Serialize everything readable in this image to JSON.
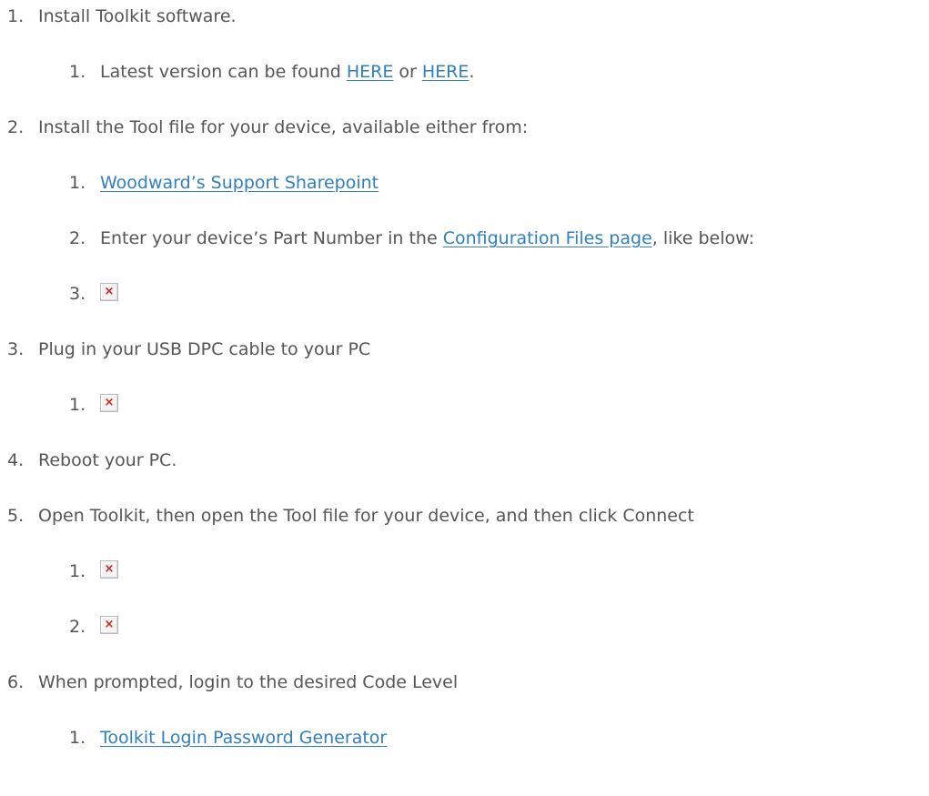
{
  "steps": [
    {
      "num": "1.",
      "text": "Install Toolkit software.",
      "sub": [
        {
          "num": "1.",
          "pre": "Latest version can be found ",
          "link1": "HERE",
          "mid": " or ",
          "link2": "HERE",
          "post": "."
        }
      ]
    },
    {
      "num": "2.",
      "text": "Install the Tool file for your device, available either from:",
      "sub": [
        {
          "num": "1.",
          "link": "Woodward’s Support Sharepoint"
        },
        {
          "num": "2.",
          "pre": "Enter your device’s Part Number in the ",
          "link": "Configuration Files page",
          "post": ", like below:"
        },
        {
          "num": "3.",
          "image": "broken-image-icon"
        }
      ]
    },
    {
      "num": "3.",
      "text": "Plug in your USB DPC cable to your PC",
      "sub": [
        {
          "num": "1.",
          "image": "broken-image-icon"
        }
      ]
    },
    {
      "num": "4.",
      "text": "Reboot your PC.",
      "sub": []
    },
    {
      "num": "5.",
      "text": "Open Toolkit, then open the Tool file for your device, and then click Connect",
      "sub": [
        {
          "num": "1.",
          "image": "broken-image-icon"
        },
        {
          "num": "2.",
          "image": "broken-image-icon"
        }
      ]
    },
    {
      "num": "6.",
      "text": "When prompted, login to the desired Code Level",
      "sub": [
        {
          "num": "1.",
          "link": "Toolkit Login Password Generator"
        }
      ]
    }
  ],
  "colors": {
    "text": "#555555",
    "link": "#2f7fc1",
    "broken_image_x": "#cc1f1f"
  }
}
